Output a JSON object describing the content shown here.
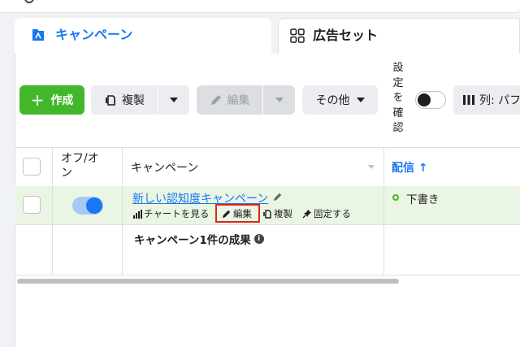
{
  "tabs": [
    {
      "label": "キャンペーン",
      "icon": "campaign-icon",
      "active": true
    },
    {
      "label": "広告セット",
      "icon": "adset-grid-icon",
      "active": false
    }
  ],
  "toolbar": {
    "create_label": "作成",
    "duplicate_label": "複製",
    "edit_label": "編集",
    "more_label": "その他",
    "columns_label": "列: パフ",
    "settings_label": "設定を確認"
  },
  "table": {
    "headers": {
      "toggle": "オフ/オン",
      "campaign": "キャンペーン",
      "delivery": "配信 ↑"
    },
    "rows": [
      {
        "name": "新しい認知度キャンペーン",
        "enabled": true,
        "actions": {
          "view_chart": "チャートを見る",
          "edit": "編集",
          "duplicate": "複製",
          "pin": "固定する"
        },
        "delivery_status": "下書き"
      }
    ],
    "summary": "キャンペーン1件の成果"
  },
  "colors": {
    "accent_blue": "#1877f2",
    "create_green": "#42b72a",
    "row_highlight": "#eaf5e4",
    "annotation_red": "#e0241b"
  }
}
